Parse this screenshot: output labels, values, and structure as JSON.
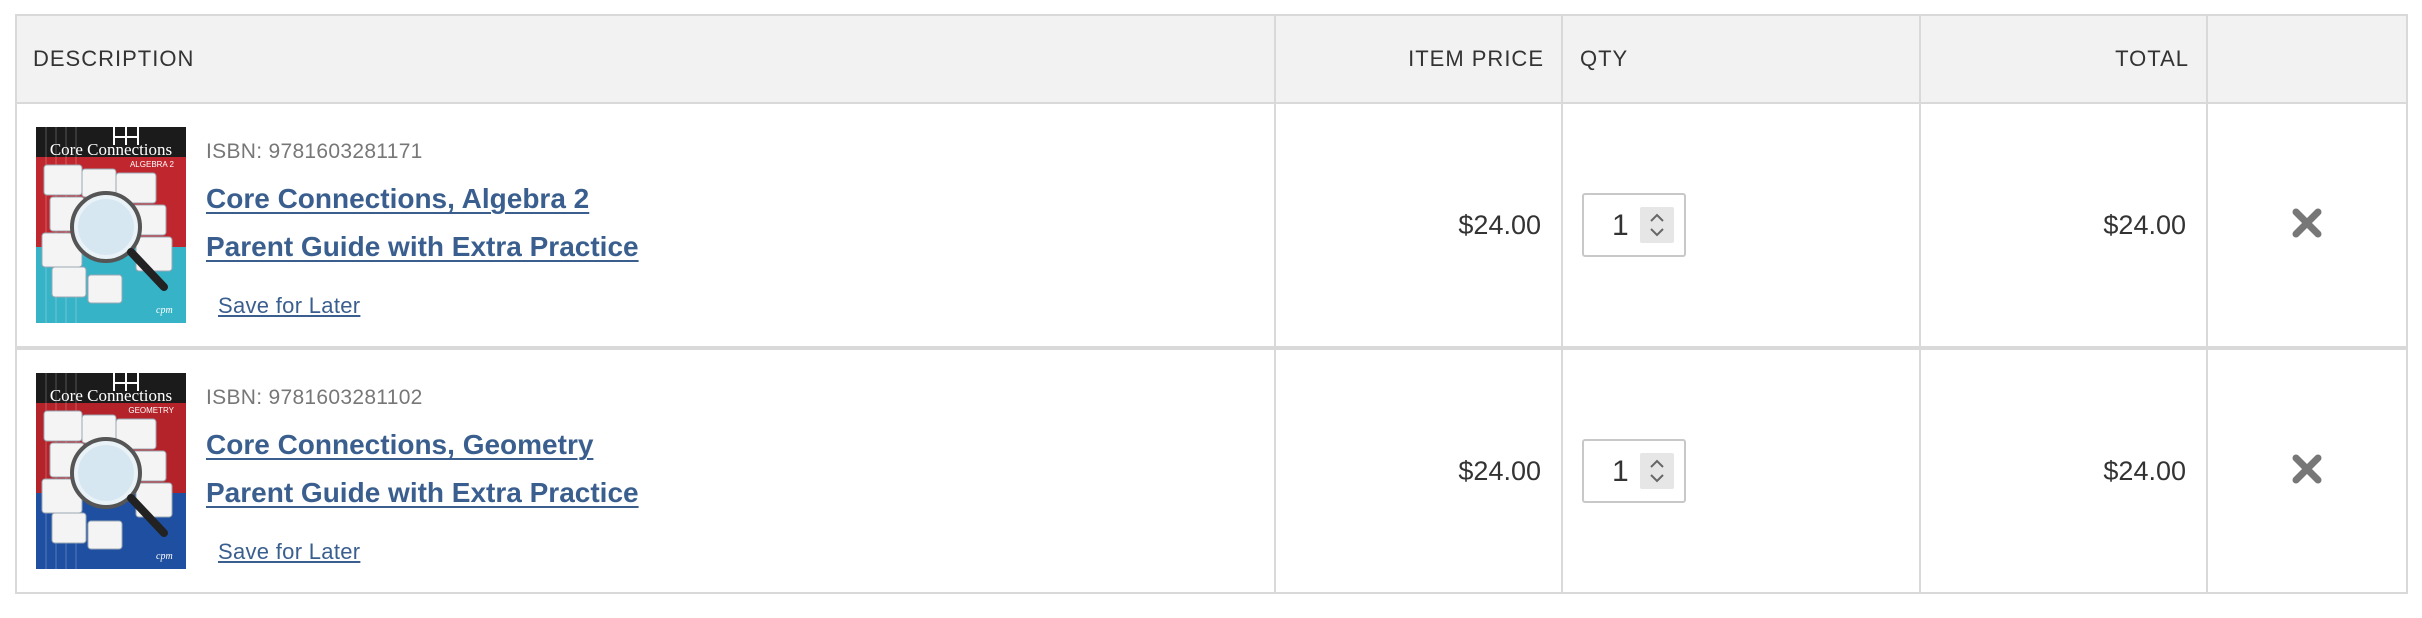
{
  "table": {
    "headers": {
      "description": "DESCRIPTION",
      "item_price": "ITEM PRICE",
      "qty": "QTY",
      "total": "TOTAL",
      "remove": ""
    },
    "rows": [
      {
        "isbn": "ISBN: 9781603281171",
        "title_line1": "Core Connections, Algebra 2",
        "title_line2": "Parent Guide with Extra Practice",
        "save_label": "Save for Later",
        "item_price": "$24.00",
        "qty": "1",
        "total": "$24.00",
        "remove_icon": "close-icon",
        "cover_title": "Core Connections",
        "cover_subtitle": "ALGEBRA 2",
        "cover_colors": {
          "top": "#1b1b1b",
          "left": "#c0262d",
          "bottom": "#36b3c7"
        }
      },
      {
        "isbn": "ISBN: 9781603281102",
        "title_line1": "Core Connections, Geometry",
        "title_line2": "Parent Guide with Extra Practice",
        "save_label": "Save for Later",
        "item_price": "$24.00",
        "qty": "1",
        "total": "$24.00",
        "remove_icon": "close-icon",
        "cover_title": "Core Connections",
        "cover_subtitle": "GEOMETRY",
        "cover_colors": {
          "top": "#1b1b1b",
          "left": "#b5232a",
          "bottom": "#1e4fa0"
        }
      }
    ]
  },
  "colors": {
    "link": "#3a5f8f",
    "header_bg": "#f2f2f2",
    "border": "#d9d9d9",
    "remove_icon": "#777777"
  }
}
